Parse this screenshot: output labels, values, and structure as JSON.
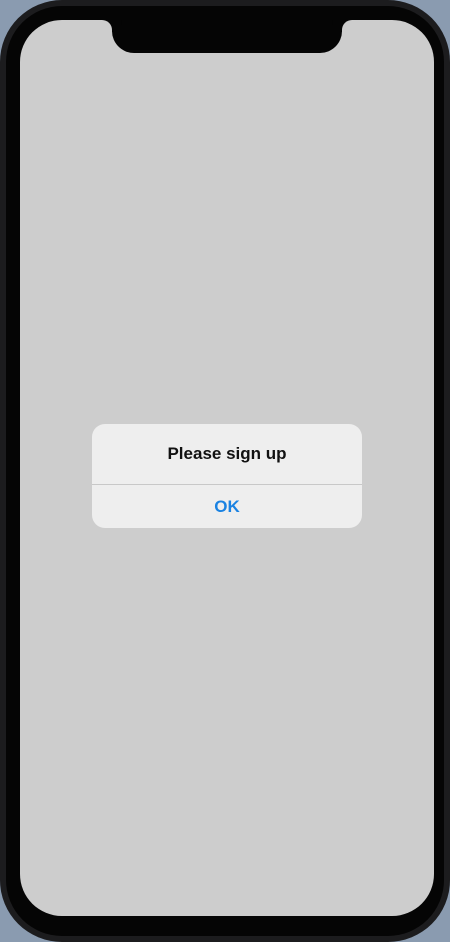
{
  "alert": {
    "title": "Please sign up",
    "ok_label": "OK"
  },
  "colors": {
    "screen_background": "#cdcdcd",
    "alert_background": "#eeeeee",
    "accent": "#1a82e2"
  }
}
